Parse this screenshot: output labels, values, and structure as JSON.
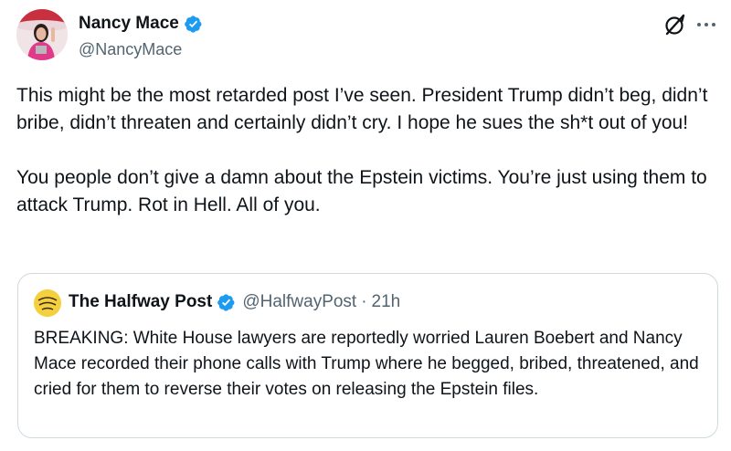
{
  "author": {
    "name": "Nancy Mace",
    "handle": "@NancyMace",
    "verified": true,
    "avatar_icon": "avatar-photo"
  },
  "actions": {
    "grok_icon": "grok-icon",
    "more_icon": "more-options-icon"
  },
  "post": {
    "paragraph_1": "This might be the most retarded post I’ve seen. President Trump didn’t beg, didn’t bribe, didn’t threaten and certainly didn’t cry. I hope he sues the sh*t out of you!",
    "paragraph_2": "You people don’t give a damn about the Epstein victims. You’re just using them to attack Trump. Rot in Hell. All of you."
  },
  "quote": {
    "name": "The Halfway Post",
    "handle": "@HalfwayPost",
    "separator": "·",
    "time": "21h",
    "verified": true,
    "avatar_icon": "halfway-post-logo",
    "text": "BREAKING: White House lawyers are reportedly worried Lauren Boebert and Nancy Mace recorded their phone calls with Trump where he begged, bribed, threatened, and cried for them to reverse their votes on releasing the Epstein files."
  },
  "colors": {
    "text": "#0f1419",
    "secondary": "#536471",
    "verified_blue": "#1d9bf0",
    "border": "#cfd9de"
  }
}
